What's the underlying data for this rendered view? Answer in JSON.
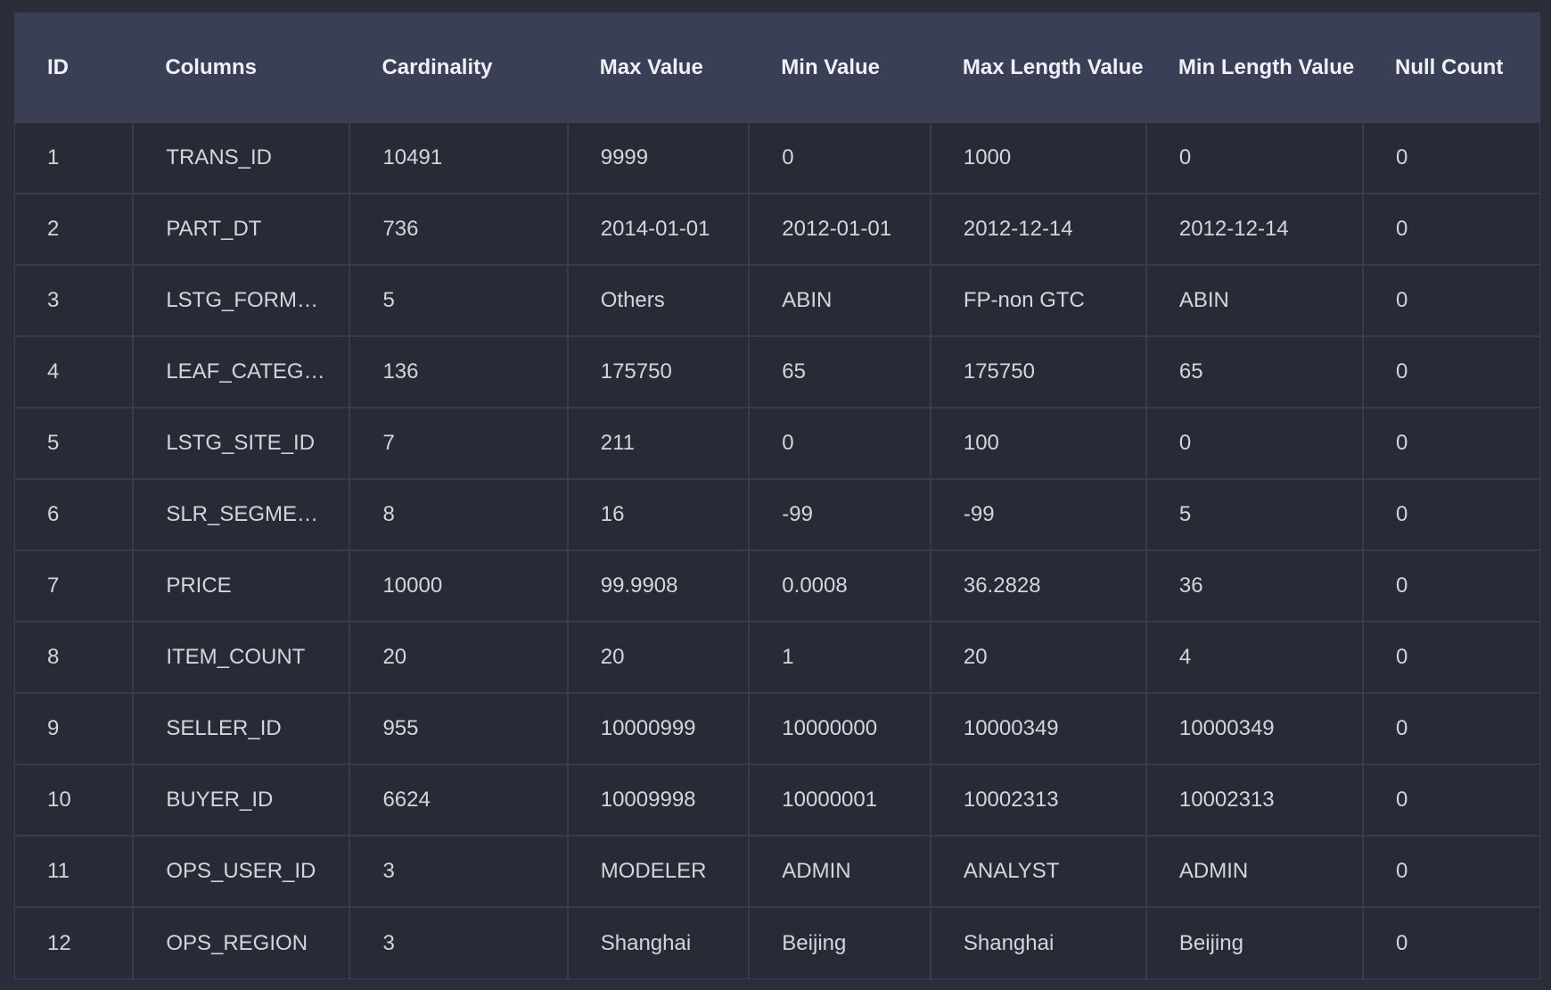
{
  "table": {
    "headers": [
      "ID",
      "Columns",
      "Cardinality",
      "Max Value",
      "Min Value",
      "Max Length Value",
      "Min Length Value",
      "Null Count"
    ],
    "rows": [
      [
        "1",
        "TRANS_ID",
        "10491",
        "9999",
        "0",
        "1000",
        "0",
        "0"
      ],
      [
        "2",
        "PART_DT",
        "736",
        "2014-01-01",
        "2012-01-01",
        "2012-12-14",
        "2012-12-14",
        "0"
      ],
      [
        "3",
        "LSTG_FORM…",
        "5",
        "Others",
        "ABIN",
        "FP-non GTC",
        "ABIN",
        "0"
      ],
      [
        "4",
        "LEAF_CATEG…",
        "136",
        "175750",
        "65",
        "175750",
        "65",
        "0"
      ],
      [
        "5",
        "LSTG_SITE_ID",
        "7",
        "211",
        "0",
        "100",
        "0",
        "0"
      ],
      [
        "6",
        "SLR_SEGME…",
        "8",
        "16",
        "-99",
        "-99",
        "5",
        "0"
      ],
      [
        "7",
        "PRICE",
        "10000",
        "99.9908",
        "0.0008",
        "36.2828",
        "36",
        "0"
      ],
      [
        "8",
        "ITEM_COUNT",
        "20",
        "20",
        "1",
        "20",
        "4",
        "0"
      ],
      [
        "9",
        "SELLER_ID",
        "955",
        "10000999",
        "10000000",
        "10000349",
        "10000349",
        "0"
      ],
      [
        "10",
        "BUYER_ID",
        "6624",
        "10009998",
        "10000001",
        "10002313",
        "10002313",
        "0"
      ],
      [
        "11",
        "OPS_USER_ID",
        "3",
        "MODELER",
        "ADMIN",
        "ANALYST",
        "ADMIN",
        "0"
      ],
      [
        "12",
        "OPS_REGION",
        "3",
        "Shanghai",
        "Beijing",
        "Shanghai",
        "Beijing",
        "0"
      ]
    ]
  }
}
